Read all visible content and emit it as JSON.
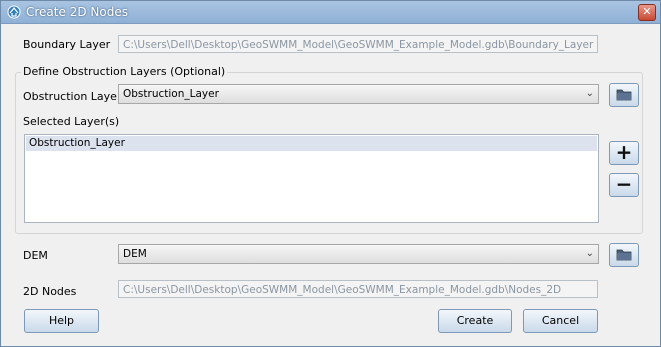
{
  "window": {
    "title": "Create 2D Nodes",
    "close_glyph": "✕"
  },
  "boundary": {
    "label": "Boundary Layer",
    "value": "C:\\Users\\Dell\\Desktop\\GeoSWMM_Model\\GeoSWMM_Example_Model.gdb\\Boundary_Layer"
  },
  "obstruction_group": {
    "title": "Define Obstruction Layers (Optional)",
    "layer_label": "Obstruction Layer",
    "layer_value": "Obstruction_Layer",
    "selected_label": "Selected Layer(s)",
    "selected_items": [
      "Obstruction_Layer"
    ],
    "add_glyph": "+",
    "remove_glyph": "−"
  },
  "dem": {
    "label": "DEM",
    "value": "DEM"
  },
  "nodes2d": {
    "label": "2D Nodes",
    "value": "C:\\Users\\Dell\\Desktop\\GeoSWMM_Model\\GeoSWMM_Example_Model.gdb\\Nodes_2D"
  },
  "buttons": {
    "help": "Help",
    "create": "Create",
    "cancel": "Cancel"
  },
  "icons": {
    "title": "app-icon",
    "browse": "folder-icon",
    "dropdown": "chevron-down-icon"
  }
}
